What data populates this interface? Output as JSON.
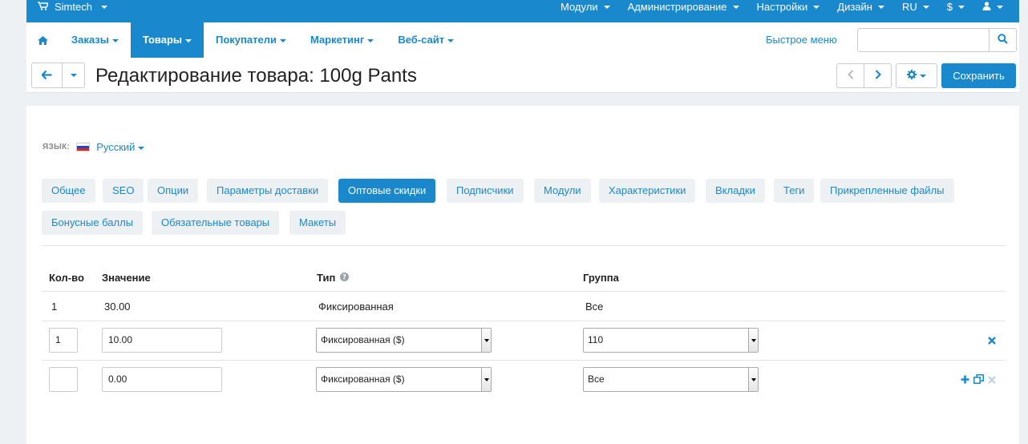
{
  "topbar": {
    "brand": "Simtech",
    "menu": [
      "Модули",
      "Администрирование",
      "Настройки",
      "Дизайн",
      "RU",
      "$",
      ""
    ]
  },
  "nav": {
    "items": [
      "Заказы",
      "Товары",
      "Покупатели",
      "Маркетинг",
      "Веб-сайт"
    ],
    "quick_menu": "Быстрое меню",
    "search_placeholder": ""
  },
  "page": {
    "title": "Редактирование товара: 100g Pants",
    "save_label": "Сохранить"
  },
  "language": {
    "label": "ЯЗЫК:",
    "value": "Русский"
  },
  "tabs": {
    "items": [
      "Общее",
      "SEO",
      "Опции",
      "Параметры доставки",
      "Оптовые скидки",
      "Подписчики",
      "Модули",
      "Характеристики",
      "Вкладки",
      "Теги",
      "Прикрепленные файлы",
      "Бонусные баллы",
      "Обязательные товары",
      "Макеты"
    ],
    "active": "Оптовые скидки"
  },
  "table": {
    "headers": [
      "Кол-во",
      "Значение",
      "Тип",
      "Группа"
    ],
    "static_row": {
      "qty": "1",
      "value": "30.00",
      "type": "Фиксированная",
      "group": "Все"
    },
    "edit_rows": [
      {
        "qty": "1",
        "value": "10.00",
        "type": "Фиксированная ($)",
        "group": "110"
      },
      {
        "qty": "",
        "value": "0.00",
        "type": "Фиксированная ($)",
        "group": "Все"
      }
    ]
  },
  "colors": {
    "accent": "#1a88cd",
    "tab_bg": "#eef1f4"
  }
}
